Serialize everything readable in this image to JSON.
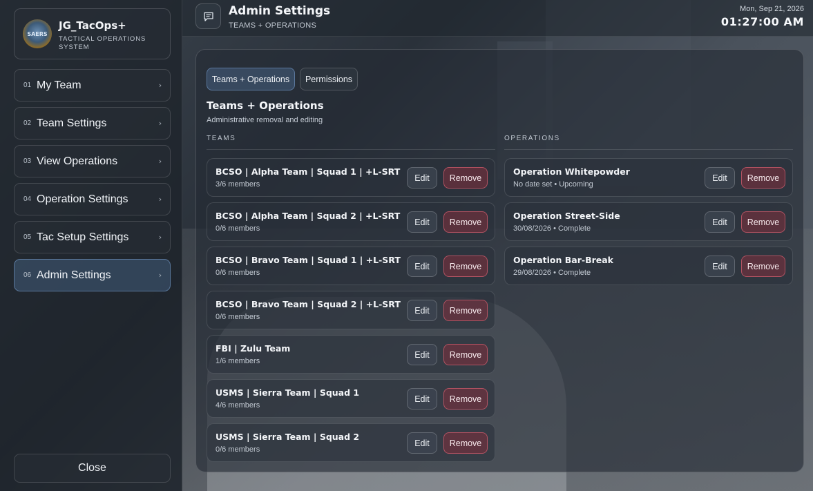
{
  "brand": {
    "logo_text": "SAERS",
    "title": "JG_TacOps+",
    "subtitle": "TACTICAL OPERATIONS SYSTEM"
  },
  "nav": [
    {
      "num": "01",
      "label": "My Team",
      "active": false
    },
    {
      "num": "02",
      "label": "Team Settings",
      "active": false
    },
    {
      "num": "03",
      "label": "View Operations",
      "active": false
    },
    {
      "num": "04",
      "label": "Operation Settings",
      "active": false
    },
    {
      "num": "05",
      "label": "Tac Setup Settings",
      "active": false
    },
    {
      "num": "06",
      "label": "Admin Settings",
      "active": true
    }
  ],
  "close_label": "Close",
  "header": {
    "title": "Admin Settings",
    "subtitle": "TEAMS + OPERATIONS",
    "date": "Mon, Sep 21, 2026",
    "time": "01:27:00 AM",
    "icon": "chat-icon"
  },
  "tabs": [
    {
      "label": "Teams + Operations",
      "active": true
    },
    {
      "label": "Permissions",
      "active": false
    }
  ],
  "section": {
    "title": "Teams + Operations",
    "subtitle": "Administrative removal and editing"
  },
  "teams_label": "TEAMS",
  "operations_label": "OPERATIONS",
  "edit_label": "Edit",
  "remove_label": "Remove",
  "teams": [
    {
      "name": "BCSO | Alpha Team | Squad 1 | +L-SRT",
      "members": "3/6 members"
    },
    {
      "name": "BCSO | Alpha Team | Squad 2 | +L-SRT",
      "members": "0/6 members"
    },
    {
      "name": "BCSO | Bravo Team | Squad 1 | +L-SRT",
      "members": "0/6 members"
    },
    {
      "name": "BCSO | Bravo Team | Squad 2 | +L-SRT",
      "members": "0/6 members"
    },
    {
      "name": "FBI | Zulu Team",
      "members": "1/6 members"
    },
    {
      "name": "USMS | Sierra Team | Squad 1",
      "members": "4/6 members"
    },
    {
      "name": "USMS | Sierra Team | Squad 2",
      "members": "0/6 members"
    }
  ],
  "operations": [
    {
      "name": "Operation Whitepowder",
      "meta": "No date set • Upcoming"
    },
    {
      "name": "Operation Street-Side",
      "meta": "30/08/2026 • Complete"
    },
    {
      "name": "Operation Bar-Break",
      "meta": "29/08/2026 • Complete"
    }
  ]
}
